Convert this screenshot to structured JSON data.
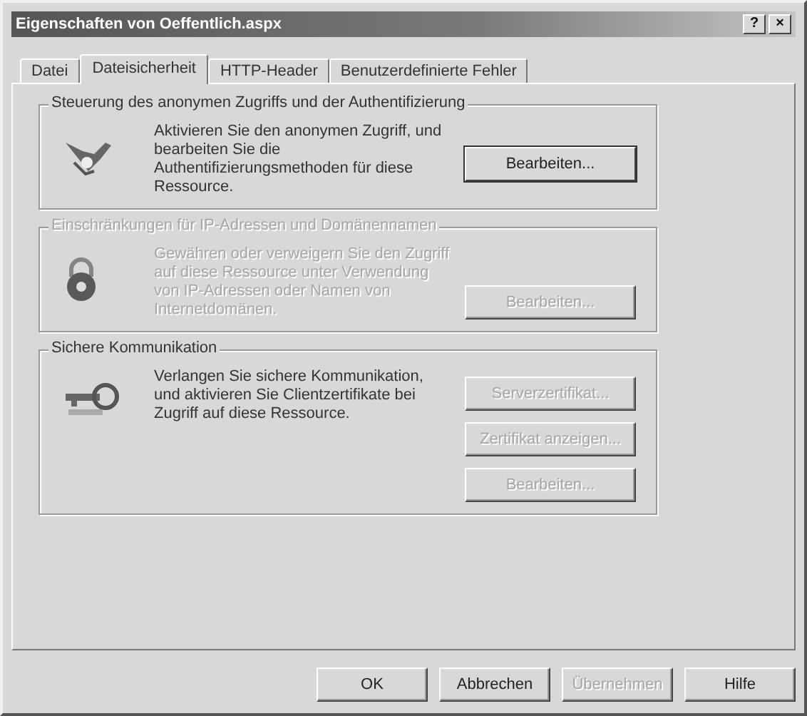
{
  "window": {
    "title": "Eigenschaften von Oeffentlich.aspx",
    "title_buttons": [
      "?",
      "×"
    ]
  },
  "tabs": [
    {
      "label": "Datei",
      "selected": false
    },
    {
      "label": "Dateisicherheit",
      "selected": true
    },
    {
      "label": "HTTP-Header",
      "selected": false
    },
    {
      "label": "Benutzerdefinierte Fehler",
      "selected": false
    }
  ],
  "groups": [
    {
      "title": "Steuerung des anonymen Zugriffs und der Authentifizierung",
      "disabled": false,
      "description": "Aktivieren Sie den anonymen Zugriff, und bearbeiten Sie die Authentifizierungsmethoden für diese Ressource.",
      "buttons": [
        {
          "label": "Bearbeiten...",
          "disabled": false
        }
      ]
    },
    {
      "title": "Einschränkungen für IP-Adressen und Domänennamen",
      "disabled": true,
      "description": "Gewähren oder verweigern Sie den Zugriff auf diese Ressource unter Verwendung von IP-Adressen oder Namen von Internetdomänen.",
      "buttons": [
        {
          "label": "Bearbeiten...",
          "disabled": true
        }
      ]
    },
    {
      "title": "Sichere Kommunikation",
      "disabled": false,
      "description": "Verlangen Sie sichere Kommunikation, und aktivieren Sie Clientzertifikate bei Zugriff auf diese Ressource.",
      "buttons": [
        {
          "label": "Serverzertifikat...",
          "disabled": true
        },
        {
          "label": "Zertifikat anzeigen...",
          "disabled": true
        },
        {
          "label": "Bearbeiten...",
          "disabled": true
        }
      ]
    }
  ],
  "footer_buttons": [
    {
      "label": "OK",
      "disabled": false
    },
    {
      "label": "Abbrechen",
      "disabled": false
    },
    {
      "label": "Übernehmen",
      "disabled": true
    },
    {
      "label": "Hilfe",
      "disabled": false
    }
  ]
}
